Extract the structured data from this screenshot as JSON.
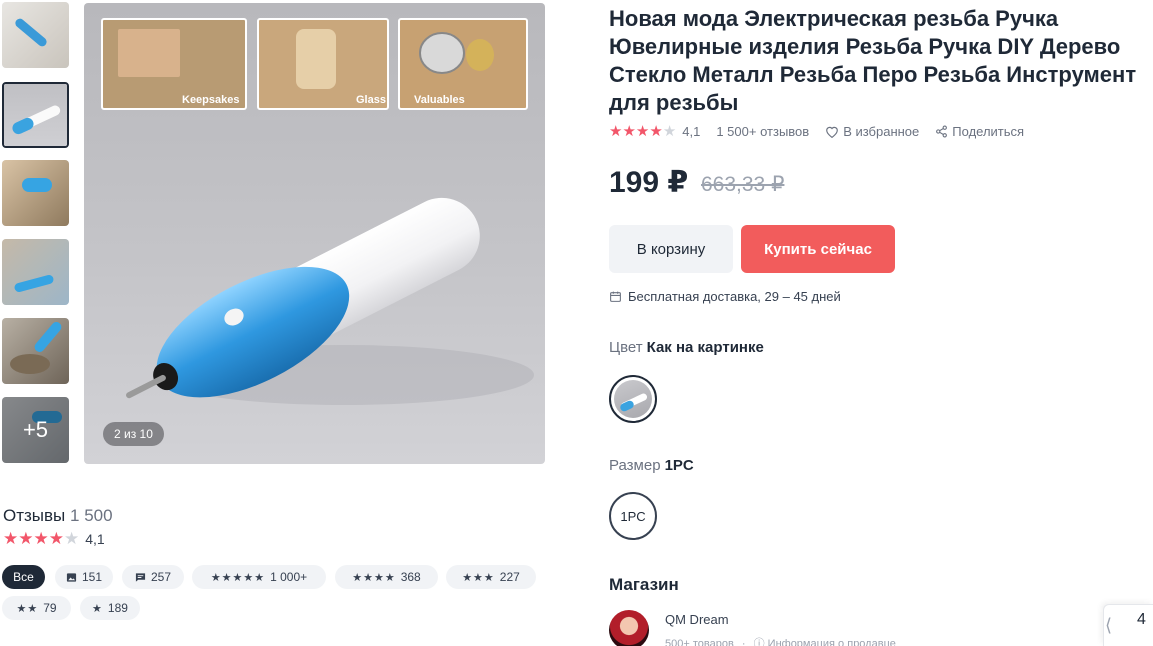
{
  "product": {
    "title": "Новая мода Электрическая резьба Ручка Ювелирные изделия Резьба Ручка DIY Дерево Стекло Металл Резьба Перо Резьба Инструмент для резьбы",
    "rating": "4,1",
    "rating_value": 4.1,
    "reviews_count": "1 500+ отзывов",
    "favorite_label": "В избранное",
    "share_label": "Поделиться",
    "price": "199 ₽",
    "old_price": "663,33 ₽",
    "cart_button": "В корзину",
    "buy_button": "Купить сейчас",
    "delivery": "Бесплатная доставка, 29 – 45 дней"
  },
  "gallery": {
    "counter": "2 из 10",
    "more_label": "+5",
    "banner_labels": [
      "Keepsakes",
      "Glass",
      "Valuables"
    ]
  },
  "options": {
    "color_label": "Цвет",
    "color_value": "Как на картинке",
    "size_label": "Размер",
    "size_value": "1PC",
    "size_option": "1PC"
  },
  "store": {
    "section_title": "Магазин",
    "name": "QM Dream",
    "products": "500+ товаров",
    "info": "Информация о продавце"
  },
  "reviews": {
    "title": "Отзывы",
    "count": "1 500",
    "rating": "4,1",
    "filters": [
      {
        "label": "Все"
      },
      {
        "label": "151"
      },
      {
        "label": "257"
      },
      {
        "label": "1 000+"
      },
      {
        "label": "368"
      },
      {
        "label": "227"
      },
      {
        "label": "79"
      },
      {
        "label": "189"
      }
    ]
  },
  "side_panel": {
    "number": "4"
  },
  "colors": {
    "accent": "#f25c5c",
    "star": "#f2566a",
    "dark": "#1f2937"
  }
}
